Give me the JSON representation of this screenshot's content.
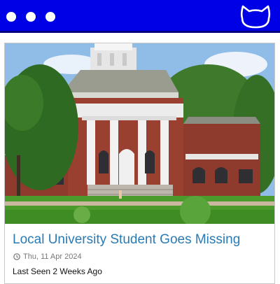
{
  "header": {
    "dots": [
      "dot",
      "dot",
      "dot"
    ],
    "logo_icon": "cat-face-icon",
    "bar_color": "#0000e6",
    "bar_border_color": "#000080"
  },
  "article": {
    "image_icon": "campus-building-photo",
    "headline": "Local University Student Goes Missing",
    "date_icon": "clock-icon",
    "date": "Thu, 11 Apr 2024",
    "summary": "Last Seen 2 Weeks Ago",
    "headline_color": "#2a7ab4"
  }
}
